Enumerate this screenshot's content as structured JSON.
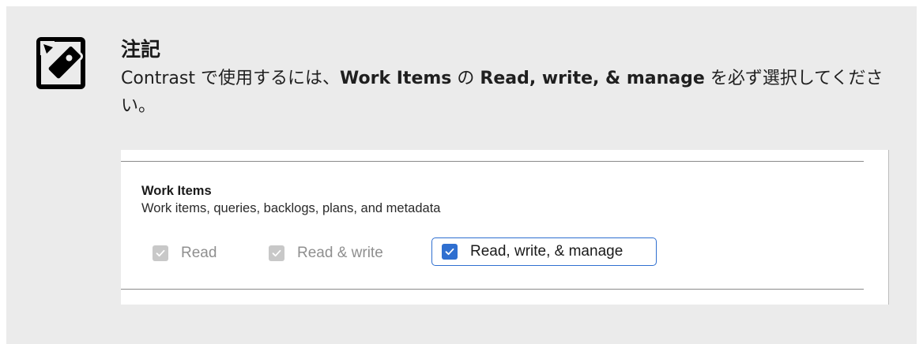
{
  "note": {
    "title": "注記",
    "text_parts": {
      "p1": "Contrast で使用するには、",
      "b1": "Work Items",
      "p2": " の ",
      "b2": "Read, write, & manage",
      "p3": " を必ず選択してください。"
    },
    "icon": "note-pencil-icon"
  },
  "panel": {
    "section_title": "Work Items",
    "section_description": "Work items, queries, backlogs, plans, and metadata",
    "options": [
      {
        "label": "Read",
        "checked": true,
        "disabled": true
      },
      {
        "label": "Read & write",
        "checked": true,
        "disabled": true
      },
      {
        "label": "Read, write, & manage",
        "checked": true,
        "disabled": false,
        "focused": true
      }
    ]
  },
  "colors": {
    "note_background": "#ebebeb",
    "accent_blue": "#2f6fd0",
    "disabled_gray": "#c8c8c8"
  }
}
